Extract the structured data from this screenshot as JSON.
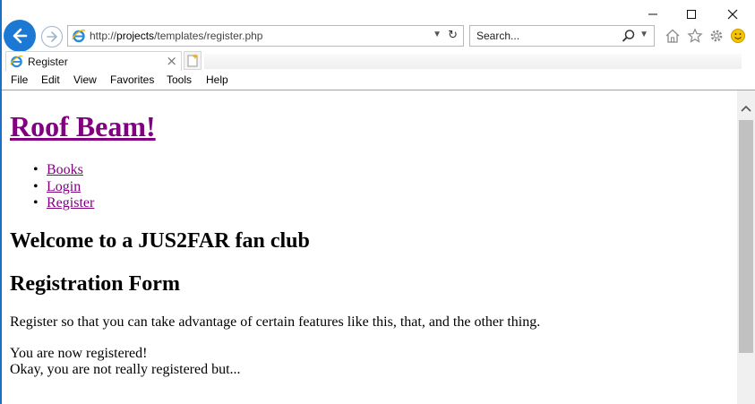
{
  "browser": {
    "address_url_prefix": "http://",
    "address_url_host": "projects",
    "address_url_path": "/templates/register.php",
    "search_placeholder": "Search...",
    "tab_title": "Register",
    "tab_close": "×",
    "menu": [
      "File",
      "Edit",
      "View",
      "Favorites",
      "Tools",
      "Help"
    ],
    "accent_color": "#1c79d3"
  },
  "page": {
    "site_title": "Roof Beam!",
    "nav": [
      "Books",
      "Login",
      "Register"
    ],
    "welcome_heading": "Welcome to a JUS2FAR fan club",
    "form_heading": "Registration Form",
    "intro_text": "Register so that you can take advantage of certain features like this, that, and the other thing.",
    "status_line1": "You are now registered!",
    "status_line2": "Okay, you are not really registered but...",
    "link_color": "#800080"
  }
}
